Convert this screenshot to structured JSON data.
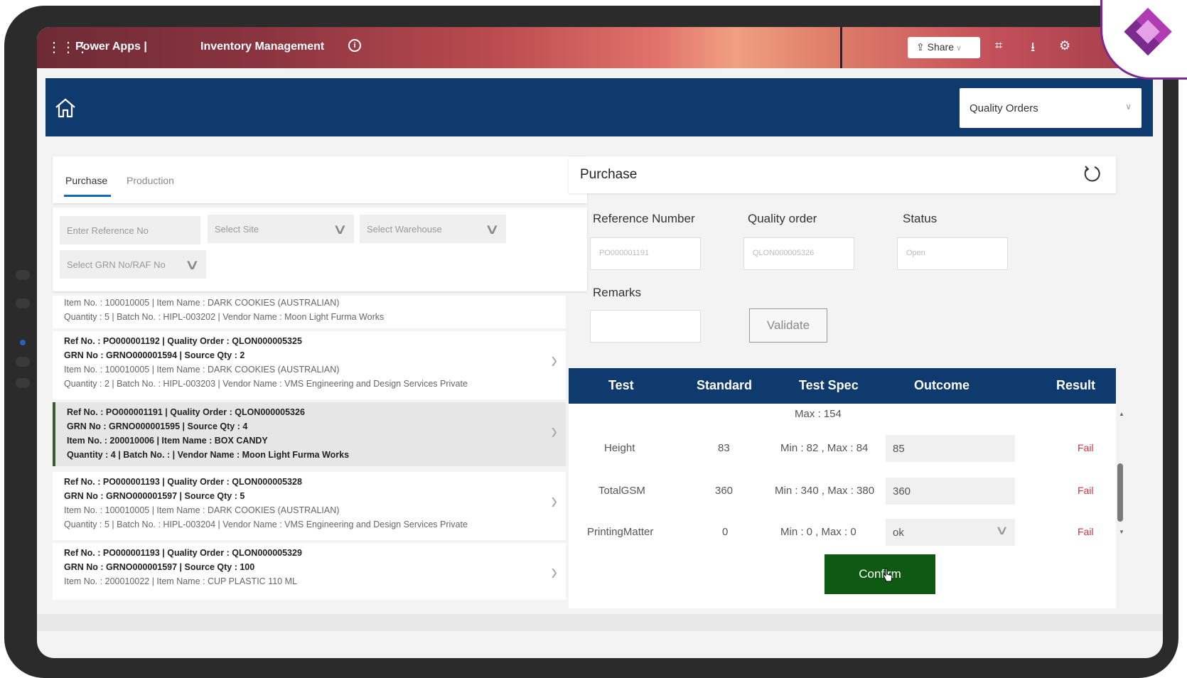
{
  "topbar": {
    "brand": "Power Apps |",
    "app_name": "Inventory Management",
    "share_label": "Share",
    "icons": [
      "waffle-icon",
      "info-icon",
      "share-icon",
      "fullscreen-icon",
      "download-icon",
      "settings-icon"
    ]
  },
  "header": {
    "module_select_value": "Quality Orders"
  },
  "left": {
    "tabs": [
      "Purchase",
      "Production"
    ],
    "filters": {
      "reference_placeholder": "Enter Reference No",
      "site_placeholder": "Select Site",
      "warehouse_placeholder": "Select Warehouse",
      "grn_placeholder": "Select GRN No/RAF No"
    },
    "items": [
      {
        "line3": "Item No. : 100010005 | Item Name : DARK COOKIES (AUSTRALIAN)",
        "line4": "Quantity : 5 | Batch No. : HIPL-003202 | Vendor Name : Moon Light Furma Works"
      },
      {
        "line1": "Ref No. : PO000001192 | Quality Order : QLON000005325",
        "line2": "GRN No : GRNO000001594 | Source Qty : 2",
        "line3": "Item No. : 100010005 | Item Name : DARK COOKIES (AUSTRALIAN)",
        "line4": "Quantity : 2 | Batch No. : HIPL-003203 | Vendor Name : VMS Engineering and Design Services Private"
      },
      {
        "line1": "Ref No. : PO000001191 | Quality Order : QLON000005326",
        "line2": "GRN No : GRNO000001595 | Source Qty : 4",
        "line3": "Item No. : 200010006 | Item Name : BOX CANDY",
        "line4": "Quantity : 4 | Batch No. : | Vendor Name : Moon Light Furma Works"
      },
      {
        "line1": "Ref No. : PO000001193 | Quality Order : QLON000005328",
        "line2": "GRN No : GRNO000001597 | Source Qty : 5",
        "line3": "Item No. : 100010005 | Item Name : DARK COOKIES (AUSTRALIAN)",
        "line4": "Quantity : 5 | Batch No. : HIPL-003204 | Vendor Name : VMS Engineering and Design Services Private"
      },
      {
        "line1": "Ref No. : PO000001193 | Quality Order : QLON000005329",
        "line2": "GRN No : GRNO000001597 | Source Qty : 100",
        "line3": "Item No. : 200010022 | Item Name : CUP PLASTIC 110 ML"
      }
    ]
  },
  "right": {
    "title": "Purchase",
    "labels": {
      "reference": "Reference Number",
      "quality_order": "Quality order",
      "status": "Status",
      "remarks": "Remarks"
    },
    "values": {
      "reference": "PO000001191",
      "quality_order": "QLON000005326",
      "status": "Open",
      "remarks": ""
    },
    "validate_label": "Validate",
    "table": {
      "headers": [
        "Test",
        "Standard",
        "Test Spec",
        "Outcome",
        "Result"
      ],
      "partial_row": {
        "spec": "Max : 154"
      },
      "rows": [
        {
          "test": "Height",
          "standard": "83",
          "spec": "Min : 82 , Max : 84",
          "outcome": "85",
          "result": "Fail"
        },
        {
          "test": "TotalGSM",
          "standard": "360",
          "spec": "Min : 340 , Max : 380",
          "outcome": "360",
          "result": "Fail"
        },
        {
          "test": "PrintingMatter",
          "standard": "0",
          "spec": "Min : 0 , Max : 0",
          "outcome": "ok",
          "result": "Fail"
        }
      ]
    },
    "confirm_label": "Confirm"
  },
  "colors": {
    "header_navy": "#0f3a6e",
    "confirm_green": "#0f5a12",
    "fail_red": "#d0343c",
    "tab_accent": "#0f6cbd",
    "logo_purple": "#7b2a8e"
  }
}
